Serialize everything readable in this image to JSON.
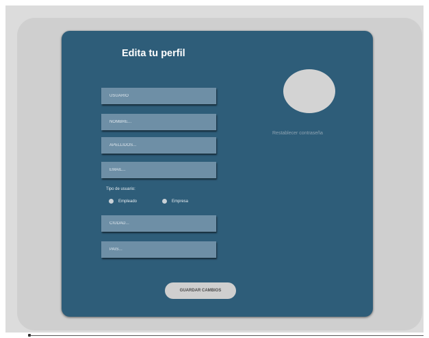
{
  "form": {
    "title": "Edita tu perfil",
    "fields": {
      "usuario": {
        "placeholder": "USUARIO"
      },
      "nombre": {
        "placeholder": "NOMBRE..."
      },
      "apellidos": {
        "placeholder": "APELLIDOS..."
      },
      "email": {
        "placeholder": "EMAIL..."
      },
      "ciudad": {
        "placeholder": "CIUDAD..."
      },
      "pais": {
        "placeholder": "PAIS..."
      }
    },
    "user_type": {
      "label": "Tipo de usuario:",
      "options": [
        {
          "label": "Empleado",
          "selected": false
        },
        {
          "label": "Empresa",
          "selected": false
        }
      ]
    },
    "save_label": "GUARDAR CAMBIOS"
  },
  "profile": {
    "reset_password_label": "Restablecer contraseña"
  },
  "colors": {
    "panel": "#2e5d79",
    "field": "#6e8fa6",
    "avatar": "#d3d3d3",
    "button": "#cfcfcf",
    "outer_card": "#cfcfcf",
    "page_background": "#dcdcdc"
  }
}
